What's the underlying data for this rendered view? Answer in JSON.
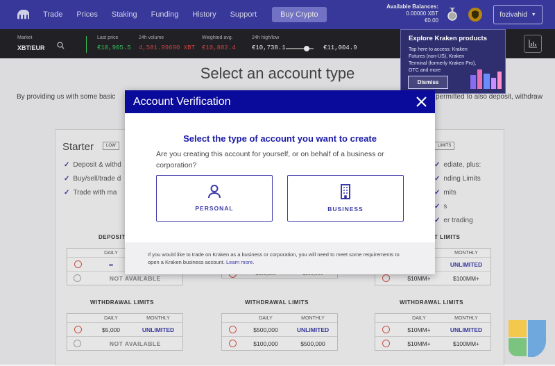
{
  "nav": {
    "links": [
      "Trade",
      "Prices",
      "Staking",
      "Funding",
      "History",
      "Support"
    ],
    "buy_label": "Buy Crypto",
    "balances_label": "Available Balances:",
    "balance_xbt": "0.00000 XBT",
    "balance_eur": "€0.00",
    "username": "fozivahid"
  },
  "ticker": {
    "market_label": "Market",
    "market": "XBT/EUR",
    "last_price_label": "Last price",
    "last_price": "€10,905.5",
    "volume_label": "24h volume",
    "volume": "4,581.99690 XBT",
    "wavg_label": "Weighted avg.",
    "wavg": "€10,882.4",
    "hilo_label": "24h high/low",
    "low": "€10,738.1",
    "high": "€11,004.9"
  },
  "promo": {
    "title": "Explore Kraken products",
    "body": "Tap here to access: Kraken Futures (non-US), Kraken Terminal (formerly Kraken Pro), OTC and more",
    "dismiss": "Dismiss"
  },
  "background": {
    "title": "Select an account type",
    "intro_left": "By providing us with some basic",
    "intro_right": "permitted to also deposit, withdraw",
    "starter": "Starter",
    "starter_badge": "LOW",
    "badge_right": "LIMITS",
    "features_left": [
      "Deposit & withd",
      "Buy/sell/trade d",
      "Trade with ma"
    ],
    "features_right": [
      "ediate, plus:",
      "nding Limits",
      "mits",
      "s",
      "er trading"
    ],
    "deposit_label": "DEPOSIT",
    "deposit_right_label": "T LIMITS",
    "withdrawal_label": "WITHDRAWAL LIMITS",
    "daily": "DAILY",
    "monthly": "MONTHLY",
    "unlimited": "UNLIMITED",
    "not_available": "NOT AVAILABLE",
    "infinity": "∞",
    "v5000": "$5,000",
    "v100k": "$100,000",
    "v500k": "$500,000",
    "v10m": "$10MM+",
    "v100m": "$100MM+"
  },
  "modal": {
    "header": "Account Verification",
    "title": "Select the type of account you want to create",
    "question": "Are you creating this account for yourself, or on behalf of a business or corporation?",
    "personal": "PERSONAL",
    "business": "BUSINESS",
    "footer": "If you would like to trade on Kraken as a business or corporation, you will need to meet some requirements to open a Kraken business account.",
    "learn_more": "Learn more."
  },
  "colors": {
    "nav": "#3a3aa8",
    "modal_header": "#0b0b9b",
    "accent": "#3a3aa8",
    "positive": "#3ad35d",
    "negative": "#e0453f"
  }
}
